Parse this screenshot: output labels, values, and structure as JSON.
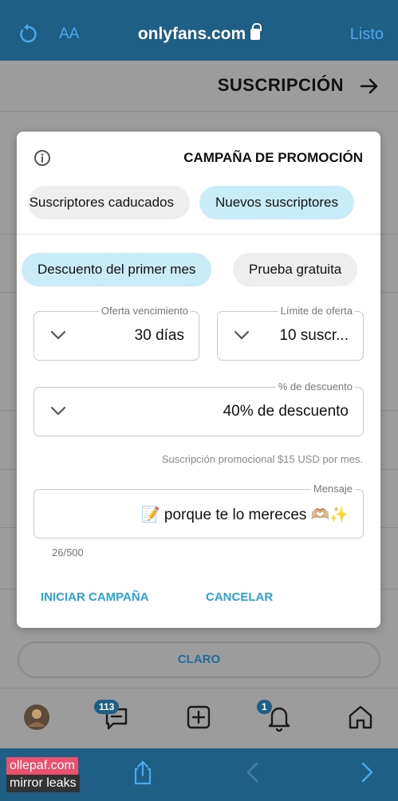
{
  "browser": {
    "url": "onlyfans.com",
    "text_size_label": "AA",
    "done_label": "Listo"
  },
  "page": {
    "title": "SUSCRIPCIÓN",
    "clear_button": "CLARO"
  },
  "modal": {
    "title": "CAMPAÑA DE PROMOCIÓN",
    "audience_tabs": [
      {
        "label": "Nuevos suscriptores",
        "active": true
      },
      {
        "label": "Suscriptores caducados",
        "active": false
      }
    ],
    "offer_tabs": [
      {
        "label": "Prueba gratuita",
        "active": false
      },
      {
        "label": "Descuento del primer mes",
        "active": true
      }
    ],
    "offer_limit": {
      "label": "Límite de oferta",
      "value": "10 suscr..."
    },
    "offer_expiration": {
      "label": "Oferta vencimiento",
      "value": "30 días"
    },
    "discount": {
      "label": "% de descuento",
      "value": "40% de descuento"
    },
    "hint": "Suscripción promocional $15 USD por mes.",
    "message": {
      "label": "Mensaje",
      "value": "📝 porque te lo mereces 🫶🏼✨"
    },
    "counter": "26/500",
    "cancel_label": "CANCELAR",
    "start_label": "INICIAR CAMPAÑA"
  },
  "tabbar": {
    "messages_badge": "113",
    "notifications_badge": "1"
  },
  "watermark": {
    "line1": "ollepaf.com",
    "line2": "mirror leaks"
  },
  "colors": {
    "safari_bar": "#1f5f86",
    "accent": "#2aa3d8",
    "active_pill": "#c8ecf8",
    "inactive_pill": "#eeeeee"
  }
}
